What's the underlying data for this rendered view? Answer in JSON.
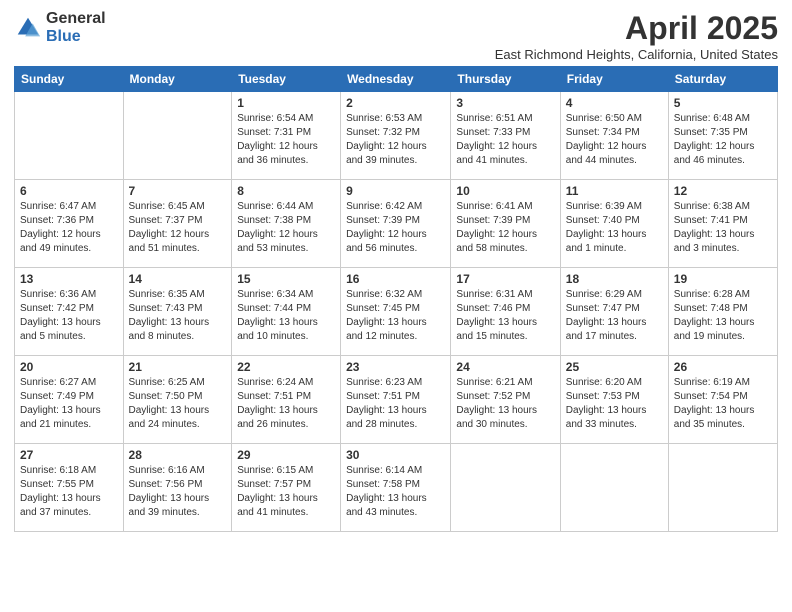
{
  "logo": {
    "general": "General",
    "blue": "Blue"
  },
  "header": {
    "title": "April 2025",
    "subtitle": "East Richmond Heights, California, United States"
  },
  "weekdays": [
    "Sunday",
    "Monday",
    "Tuesday",
    "Wednesday",
    "Thursday",
    "Friday",
    "Saturday"
  ],
  "weeks": [
    [
      {
        "day": "",
        "info": ""
      },
      {
        "day": "",
        "info": ""
      },
      {
        "day": "1",
        "info": "Sunrise: 6:54 AM\nSunset: 7:31 PM\nDaylight: 12 hours and 36 minutes."
      },
      {
        "day": "2",
        "info": "Sunrise: 6:53 AM\nSunset: 7:32 PM\nDaylight: 12 hours and 39 minutes."
      },
      {
        "day": "3",
        "info": "Sunrise: 6:51 AM\nSunset: 7:33 PM\nDaylight: 12 hours and 41 minutes."
      },
      {
        "day": "4",
        "info": "Sunrise: 6:50 AM\nSunset: 7:34 PM\nDaylight: 12 hours and 44 minutes."
      },
      {
        "day": "5",
        "info": "Sunrise: 6:48 AM\nSunset: 7:35 PM\nDaylight: 12 hours and 46 minutes."
      }
    ],
    [
      {
        "day": "6",
        "info": "Sunrise: 6:47 AM\nSunset: 7:36 PM\nDaylight: 12 hours and 49 minutes."
      },
      {
        "day": "7",
        "info": "Sunrise: 6:45 AM\nSunset: 7:37 PM\nDaylight: 12 hours and 51 minutes."
      },
      {
        "day": "8",
        "info": "Sunrise: 6:44 AM\nSunset: 7:38 PM\nDaylight: 12 hours and 53 minutes."
      },
      {
        "day": "9",
        "info": "Sunrise: 6:42 AM\nSunset: 7:39 PM\nDaylight: 12 hours and 56 minutes."
      },
      {
        "day": "10",
        "info": "Sunrise: 6:41 AM\nSunset: 7:39 PM\nDaylight: 12 hours and 58 minutes."
      },
      {
        "day": "11",
        "info": "Sunrise: 6:39 AM\nSunset: 7:40 PM\nDaylight: 13 hours and 1 minute."
      },
      {
        "day": "12",
        "info": "Sunrise: 6:38 AM\nSunset: 7:41 PM\nDaylight: 13 hours and 3 minutes."
      }
    ],
    [
      {
        "day": "13",
        "info": "Sunrise: 6:36 AM\nSunset: 7:42 PM\nDaylight: 13 hours and 5 minutes."
      },
      {
        "day": "14",
        "info": "Sunrise: 6:35 AM\nSunset: 7:43 PM\nDaylight: 13 hours and 8 minutes."
      },
      {
        "day": "15",
        "info": "Sunrise: 6:34 AM\nSunset: 7:44 PM\nDaylight: 13 hours and 10 minutes."
      },
      {
        "day": "16",
        "info": "Sunrise: 6:32 AM\nSunset: 7:45 PM\nDaylight: 13 hours and 12 minutes."
      },
      {
        "day": "17",
        "info": "Sunrise: 6:31 AM\nSunset: 7:46 PM\nDaylight: 13 hours and 15 minutes."
      },
      {
        "day": "18",
        "info": "Sunrise: 6:29 AM\nSunset: 7:47 PM\nDaylight: 13 hours and 17 minutes."
      },
      {
        "day": "19",
        "info": "Sunrise: 6:28 AM\nSunset: 7:48 PM\nDaylight: 13 hours and 19 minutes."
      }
    ],
    [
      {
        "day": "20",
        "info": "Sunrise: 6:27 AM\nSunset: 7:49 PM\nDaylight: 13 hours and 21 minutes."
      },
      {
        "day": "21",
        "info": "Sunrise: 6:25 AM\nSunset: 7:50 PM\nDaylight: 13 hours and 24 minutes."
      },
      {
        "day": "22",
        "info": "Sunrise: 6:24 AM\nSunset: 7:51 PM\nDaylight: 13 hours and 26 minutes."
      },
      {
        "day": "23",
        "info": "Sunrise: 6:23 AM\nSunset: 7:51 PM\nDaylight: 13 hours and 28 minutes."
      },
      {
        "day": "24",
        "info": "Sunrise: 6:21 AM\nSunset: 7:52 PM\nDaylight: 13 hours and 30 minutes."
      },
      {
        "day": "25",
        "info": "Sunrise: 6:20 AM\nSunset: 7:53 PM\nDaylight: 13 hours and 33 minutes."
      },
      {
        "day": "26",
        "info": "Sunrise: 6:19 AM\nSunset: 7:54 PM\nDaylight: 13 hours and 35 minutes."
      }
    ],
    [
      {
        "day": "27",
        "info": "Sunrise: 6:18 AM\nSunset: 7:55 PM\nDaylight: 13 hours and 37 minutes."
      },
      {
        "day": "28",
        "info": "Sunrise: 6:16 AM\nSunset: 7:56 PM\nDaylight: 13 hours and 39 minutes."
      },
      {
        "day": "29",
        "info": "Sunrise: 6:15 AM\nSunset: 7:57 PM\nDaylight: 13 hours and 41 minutes."
      },
      {
        "day": "30",
        "info": "Sunrise: 6:14 AM\nSunset: 7:58 PM\nDaylight: 13 hours and 43 minutes."
      },
      {
        "day": "",
        "info": ""
      },
      {
        "day": "",
        "info": ""
      },
      {
        "day": "",
        "info": ""
      }
    ]
  ]
}
